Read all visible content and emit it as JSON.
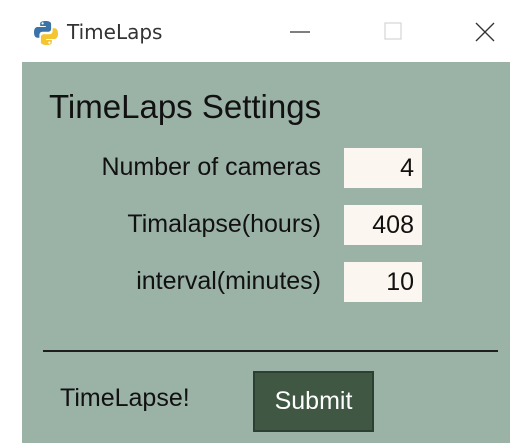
{
  "window": {
    "title": "TimeLaps",
    "app_icon": "python-logo-icon",
    "controls": [
      "minimize-icon",
      "maximize-icon",
      "close-icon"
    ]
  },
  "settings": {
    "heading": "TimeLaps Settings",
    "fields": [
      {
        "label": "Number of cameras",
        "value": "4"
      },
      {
        "label": "Timalapse(hours)",
        "value": "408"
      },
      {
        "label": "interval(minutes)",
        "value": "10"
      }
    ]
  },
  "footer": {
    "label": "TimeLapse!",
    "submit_label": "Submit"
  },
  "colors": {
    "background": "#9bb2a6",
    "button": "#3f5743",
    "field": "#fbf6ef"
  }
}
